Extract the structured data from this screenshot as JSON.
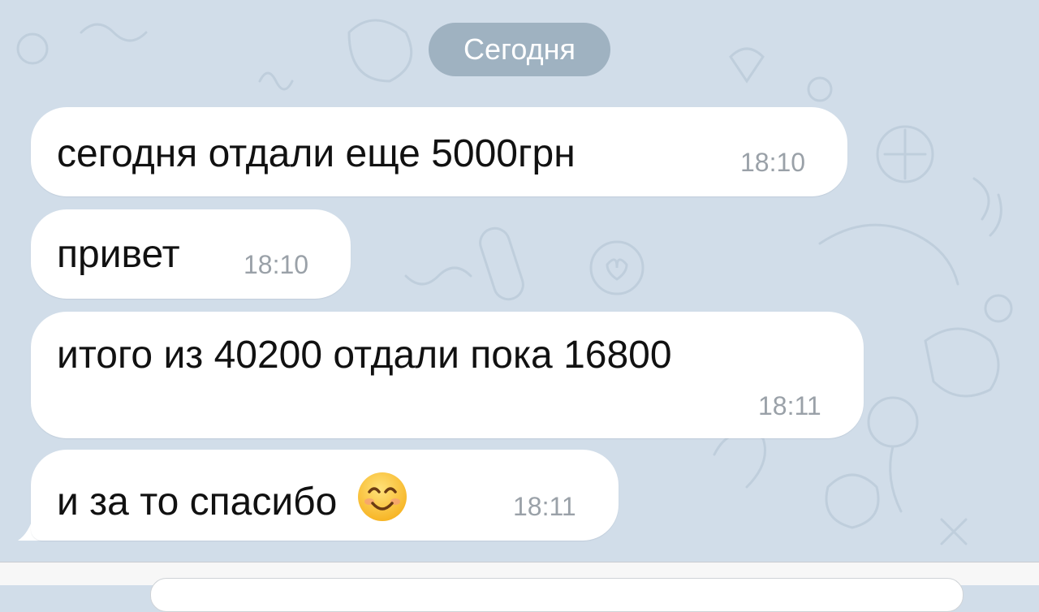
{
  "chat": {
    "date_separator": "Сегодня",
    "messages": [
      {
        "text": "сегодня отдали еще 5000грн",
        "time": "18:10"
      },
      {
        "text": "привет",
        "time": "18:10"
      },
      {
        "text": "итого из 40200 отдали пока 16800",
        "time": "18:11"
      },
      {
        "text": "и за то спасибо",
        "time": "18:11",
        "emoji": "smiling-face-emoji"
      }
    ]
  },
  "colors": {
    "background": "#d1dde9",
    "bubble": "#ffffff",
    "date_pill": "#91a5b6",
    "time_text": "#9aa1a8"
  }
}
